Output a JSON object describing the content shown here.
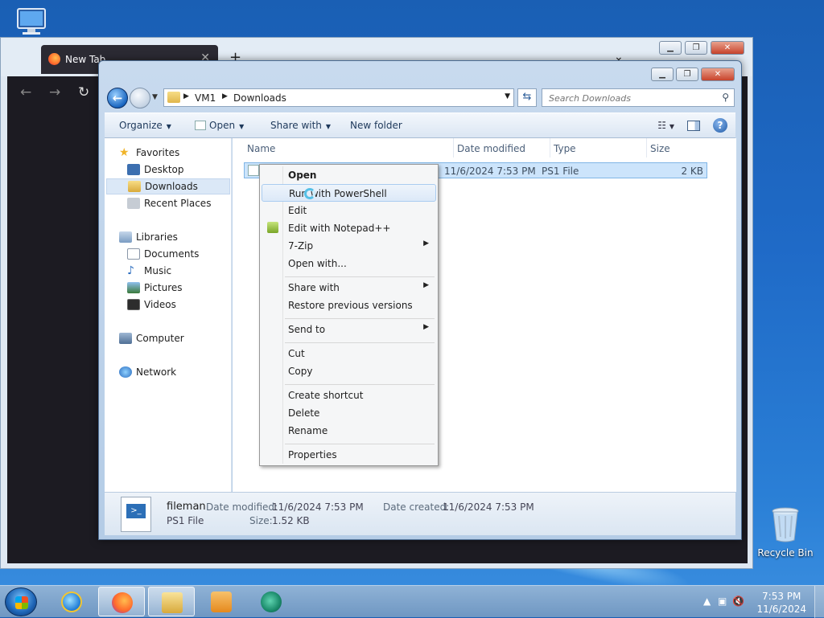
{
  "desktop": {
    "icons": [
      {
        "name": "computer-desktop-icon",
        "label": ""
      },
      {
        "name": "recycle-bin-icon",
        "label": "Recycle Bin"
      }
    ]
  },
  "browser": {
    "tab_title": "New Tab",
    "tab_close": "✕",
    "new_tab": "+",
    "chevron": "⌄",
    "nav": {
      "back": "←",
      "forward": "→",
      "reload": "↻"
    }
  },
  "explorer": {
    "address": {
      "crumbs": [
        "VM1",
        "Downloads"
      ]
    },
    "search_placeholder": "Search Downloads",
    "toolbar": {
      "organize": "Organize",
      "open": "Open",
      "share_with": "Share with",
      "new_folder": "New folder"
    },
    "nav_pane": {
      "favorites": "Favorites",
      "desktop": "Desktop",
      "downloads": "Downloads",
      "recent_places": "Recent Places",
      "libraries": "Libraries",
      "documents": "Documents",
      "music": "Music",
      "pictures": "Pictures",
      "videos": "Videos",
      "computer": "Computer",
      "network": "Network"
    },
    "columns": [
      "Name",
      "Date modified",
      "Type",
      "Size"
    ],
    "files": [
      {
        "name": "fileman",
        "date_modified": "11/6/2024 7:53 PM",
        "type": "PS1 File",
        "size": "2 KB"
      }
    ],
    "details": {
      "name": "fileman",
      "type": "PS1 File",
      "date_modified_label": "Date modified:",
      "date_modified": "11/6/2024 7:53 PM",
      "date_created_label": "Date created:",
      "date_created": "11/6/2024 7:53 PM",
      "size_label": "Size:",
      "size": "1.52 KB"
    }
  },
  "context_menu": {
    "open": "Open",
    "run_with_powershell": "Run with PowerShell",
    "edit": "Edit",
    "edit_with_notepadpp": "Edit with Notepad++",
    "seven_zip": "7-Zip",
    "open_with": "Open with...",
    "share_with": "Share with",
    "restore_previous_versions": "Restore previous versions",
    "send_to": "Send to",
    "cut": "Cut",
    "copy": "Copy",
    "create_shortcut": "Create shortcut",
    "delete": "Delete",
    "rename": "Rename",
    "properties": "Properties"
  },
  "taskbar": {
    "time": "7:53 PM",
    "date": "11/6/2024"
  },
  "colors": {
    "selection": "#cce4fb",
    "taskbar": "#7fa4cc",
    "desktop": "#1f6ac7"
  }
}
